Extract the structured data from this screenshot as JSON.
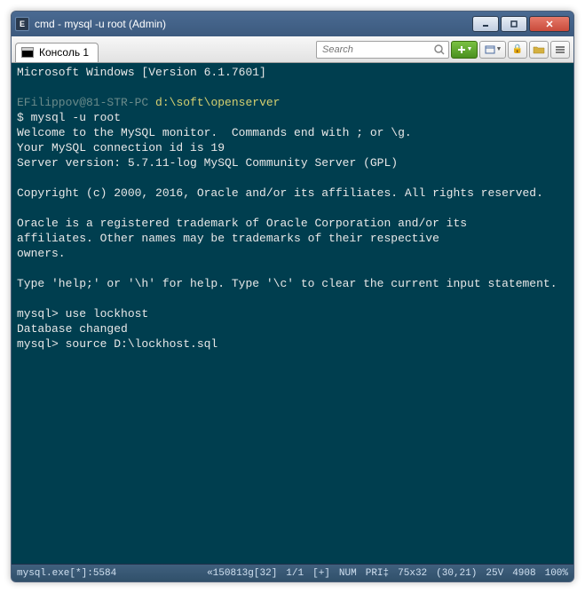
{
  "window": {
    "title": "cmd - mysql  -u root (Admin)",
    "icon_letter": "E"
  },
  "tabs": [
    {
      "label": "Консоль 1"
    }
  ],
  "search": {
    "placeholder": "Search"
  },
  "terminal": {
    "lines": [
      {
        "type": "plain",
        "text": "Microsoft Windows [Version 6.1.7601]"
      },
      {
        "type": "blank"
      },
      {
        "type": "prompt",
        "user": "EFilippov@81-STR-PC",
        "path": "d:\\soft\\openserver"
      },
      {
        "type": "plain",
        "text": "$ mysql -u root"
      },
      {
        "type": "plain",
        "text": "Welcome to the MySQL monitor.  Commands end with ; or \\g."
      },
      {
        "type": "plain",
        "text": "Your MySQL connection id is 19"
      },
      {
        "type": "plain",
        "text": "Server version: 5.7.11-log MySQL Community Server (GPL)"
      },
      {
        "type": "blank"
      },
      {
        "type": "plain",
        "text": "Copyright (c) 2000, 2016, Oracle and/or its affiliates. All rights reserved."
      },
      {
        "type": "blank"
      },
      {
        "type": "plain",
        "text": "Oracle is a registered trademark of Oracle Corporation and/or its"
      },
      {
        "type": "plain",
        "text": "affiliates. Other names may be trademarks of their respective"
      },
      {
        "type": "plain",
        "text": "owners."
      },
      {
        "type": "blank"
      },
      {
        "type": "plain",
        "text": "Type 'help;' or '\\h' for help. Type '\\c' to clear the current input statement."
      },
      {
        "type": "blank"
      },
      {
        "type": "plain",
        "text": "mysql> use lockhost"
      },
      {
        "type": "plain",
        "text": "Database changed"
      },
      {
        "type": "plain",
        "text": "mysql> source D:\\lockhost.sql"
      }
    ]
  },
  "statusbar": {
    "process": "mysql.exe[*]:5584",
    "encoding": "«150813g[32]",
    "lines": "1/1",
    "mode": "[+]",
    "num": "NUM",
    "pri": "PRI‡",
    "size": "75x32",
    "cursor": "(30,21)",
    "v": "25V",
    "mem": "4908",
    "zoom": "100%"
  }
}
